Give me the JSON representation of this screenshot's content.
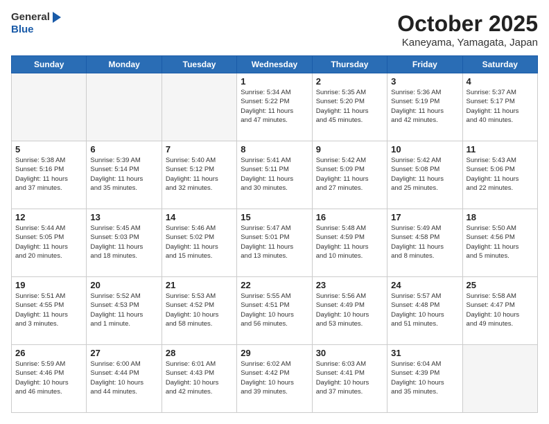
{
  "logo": {
    "line1": "General",
    "line2": "Blue"
  },
  "title": "October 2025",
  "subtitle": "Kaneyama, Yamagata, Japan",
  "days_of_week": [
    "Sunday",
    "Monday",
    "Tuesday",
    "Wednesday",
    "Thursday",
    "Friday",
    "Saturday"
  ],
  "weeks": [
    [
      {
        "day": "",
        "info": ""
      },
      {
        "day": "",
        "info": ""
      },
      {
        "day": "",
        "info": ""
      },
      {
        "day": "1",
        "info": "Sunrise: 5:34 AM\nSunset: 5:22 PM\nDaylight: 11 hours\nand 47 minutes."
      },
      {
        "day": "2",
        "info": "Sunrise: 5:35 AM\nSunset: 5:20 PM\nDaylight: 11 hours\nand 45 minutes."
      },
      {
        "day": "3",
        "info": "Sunrise: 5:36 AM\nSunset: 5:19 PM\nDaylight: 11 hours\nand 42 minutes."
      },
      {
        "day": "4",
        "info": "Sunrise: 5:37 AM\nSunset: 5:17 PM\nDaylight: 11 hours\nand 40 minutes."
      }
    ],
    [
      {
        "day": "5",
        "info": "Sunrise: 5:38 AM\nSunset: 5:16 PM\nDaylight: 11 hours\nand 37 minutes."
      },
      {
        "day": "6",
        "info": "Sunrise: 5:39 AM\nSunset: 5:14 PM\nDaylight: 11 hours\nand 35 minutes."
      },
      {
        "day": "7",
        "info": "Sunrise: 5:40 AM\nSunset: 5:12 PM\nDaylight: 11 hours\nand 32 minutes."
      },
      {
        "day": "8",
        "info": "Sunrise: 5:41 AM\nSunset: 5:11 PM\nDaylight: 11 hours\nand 30 minutes."
      },
      {
        "day": "9",
        "info": "Sunrise: 5:42 AM\nSunset: 5:09 PM\nDaylight: 11 hours\nand 27 minutes."
      },
      {
        "day": "10",
        "info": "Sunrise: 5:42 AM\nSunset: 5:08 PM\nDaylight: 11 hours\nand 25 minutes."
      },
      {
        "day": "11",
        "info": "Sunrise: 5:43 AM\nSunset: 5:06 PM\nDaylight: 11 hours\nand 22 minutes."
      }
    ],
    [
      {
        "day": "12",
        "info": "Sunrise: 5:44 AM\nSunset: 5:05 PM\nDaylight: 11 hours\nand 20 minutes."
      },
      {
        "day": "13",
        "info": "Sunrise: 5:45 AM\nSunset: 5:03 PM\nDaylight: 11 hours\nand 18 minutes."
      },
      {
        "day": "14",
        "info": "Sunrise: 5:46 AM\nSunset: 5:02 PM\nDaylight: 11 hours\nand 15 minutes."
      },
      {
        "day": "15",
        "info": "Sunrise: 5:47 AM\nSunset: 5:01 PM\nDaylight: 11 hours\nand 13 minutes."
      },
      {
        "day": "16",
        "info": "Sunrise: 5:48 AM\nSunset: 4:59 PM\nDaylight: 11 hours\nand 10 minutes."
      },
      {
        "day": "17",
        "info": "Sunrise: 5:49 AM\nSunset: 4:58 PM\nDaylight: 11 hours\nand 8 minutes."
      },
      {
        "day": "18",
        "info": "Sunrise: 5:50 AM\nSunset: 4:56 PM\nDaylight: 11 hours\nand 5 minutes."
      }
    ],
    [
      {
        "day": "19",
        "info": "Sunrise: 5:51 AM\nSunset: 4:55 PM\nDaylight: 11 hours\nand 3 minutes."
      },
      {
        "day": "20",
        "info": "Sunrise: 5:52 AM\nSunset: 4:53 PM\nDaylight: 11 hours\nand 1 minute."
      },
      {
        "day": "21",
        "info": "Sunrise: 5:53 AM\nSunset: 4:52 PM\nDaylight: 10 hours\nand 58 minutes."
      },
      {
        "day": "22",
        "info": "Sunrise: 5:55 AM\nSunset: 4:51 PM\nDaylight: 10 hours\nand 56 minutes."
      },
      {
        "day": "23",
        "info": "Sunrise: 5:56 AM\nSunset: 4:49 PM\nDaylight: 10 hours\nand 53 minutes."
      },
      {
        "day": "24",
        "info": "Sunrise: 5:57 AM\nSunset: 4:48 PM\nDaylight: 10 hours\nand 51 minutes."
      },
      {
        "day": "25",
        "info": "Sunrise: 5:58 AM\nSunset: 4:47 PM\nDaylight: 10 hours\nand 49 minutes."
      }
    ],
    [
      {
        "day": "26",
        "info": "Sunrise: 5:59 AM\nSunset: 4:46 PM\nDaylight: 10 hours\nand 46 minutes."
      },
      {
        "day": "27",
        "info": "Sunrise: 6:00 AM\nSunset: 4:44 PM\nDaylight: 10 hours\nand 44 minutes."
      },
      {
        "day": "28",
        "info": "Sunrise: 6:01 AM\nSunset: 4:43 PM\nDaylight: 10 hours\nand 42 minutes."
      },
      {
        "day": "29",
        "info": "Sunrise: 6:02 AM\nSunset: 4:42 PM\nDaylight: 10 hours\nand 39 minutes."
      },
      {
        "day": "30",
        "info": "Sunrise: 6:03 AM\nSunset: 4:41 PM\nDaylight: 10 hours\nand 37 minutes."
      },
      {
        "day": "31",
        "info": "Sunrise: 6:04 AM\nSunset: 4:39 PM\nDaylight: 10 hours\nand 35 minutes."
      },
      {
        "day": "",
        "info": ""
      }
    ]
  ]
}
